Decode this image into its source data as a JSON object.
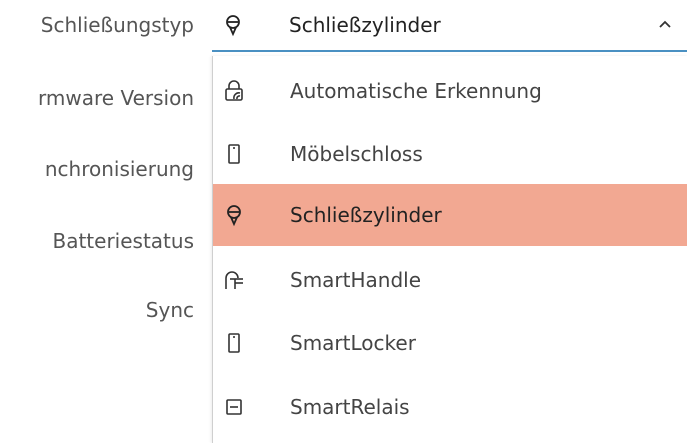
{
  "labels": [
    "Schließungstyp",
    "rmware Version",
    "nchronisierung",
    "Batteriestatus",
    "Sync"
  ],
  "combo": {
    "selected_value": "Schließzylinder",
    "icon": "cylinder-icon"
  },
  "dropdown": {
    "options": [
      {
        "label": "Automatische Erkennung",
        "icon": "auto-detect-icon",
        "selected": false
      },
      {
        "label": "Möbelschloss",
        "icon": "furniture-lock-icon",
        "selected": false
      },
      {
        "label": "Schließzylinder",
        "icon": "cylinder-icon",
        "selected": true
      },
      {
        "label": "SmartHandle",
        "icon": "smarthandle-icon",
        "selected": false
      },
      {
        "label": "SmartLocker",
        "icon": "smartlocker-icon",
        "selected": false
      },
      {
        "label": "SmartRelais",
        "icon": "smartrelais-icon",
        "selected": false
      }
    ]
  },
  "colors": {
    "selected_bg": "#f2a892",
    "underline": "#4a90c2"
  }
}
